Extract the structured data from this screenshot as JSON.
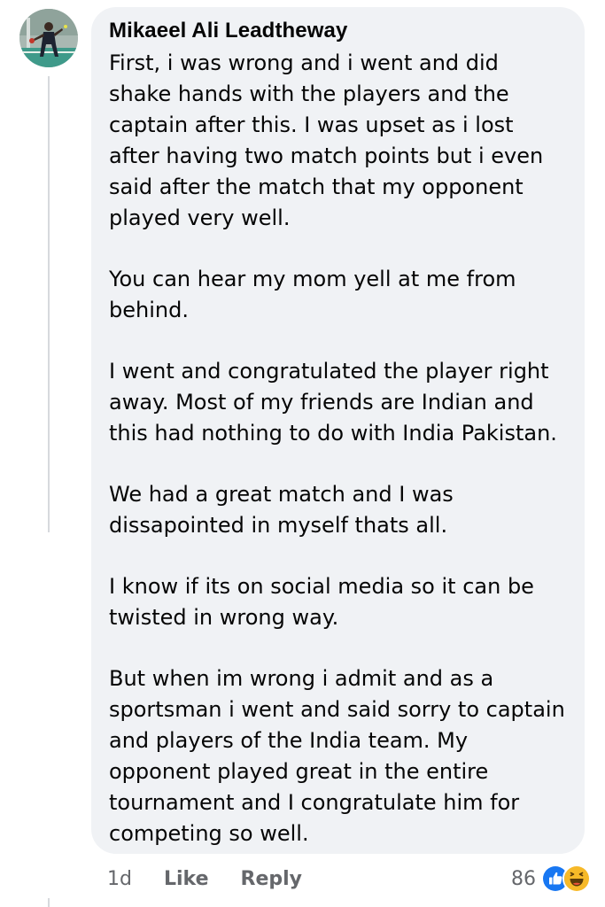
{
  "comment": {
    "author": "Mikaeel Ali Leadtheway",
    "paragraphs": [
      "First, i was wrong and i went and did shake hands with the players and the captain after this. I was upset as i lost after having two match points but i even said after the match that my opponent played very well.",
      "You can hear my mom yell at me from behind.",
      "I went and congratulated the player right away. Most of my friends are Indian and this had nothing to do with India Pakistan.",
      "We had a great match and I was dissapointed in myself thats all.",
      "I know if its on social media so it can be twisted in wrong way.",
      "But when im wrong i admit and as a sportsman i went and said sorry to captain and players of the India team. My opponent played great in the entire tournament and I congratulate him for competing so well."
    ],
    "timestamp": "1d",
    "like_label": "Like",
    "reply_label": "Reply",
    "reaction_count": "86",
    "reactions": [
      "like-icon",
      "haha-icon"
    ]
  },
  "colors": {
    "bubble_bg": "#f0f2f5",
    "text": "#050505",
    "meta_text": "#65676b",
    "like_blue": "#1877f2",
    "haha_yellow": "#f7b928"
  }
}
